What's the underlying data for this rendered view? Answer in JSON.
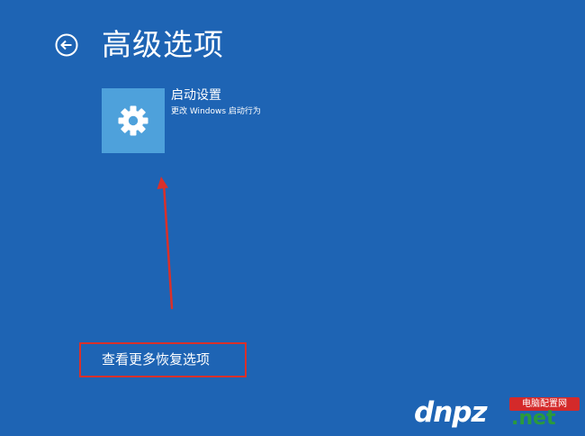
{
  "header": {
    "title": "高级选项",
    "back_icon": "back-arrow-circle-icon"
  },
  "options": [
    {
      "title": "启动设置",
      "description": "更改 Windows 启动行为",
      "icon": "gear-icon",
      "tile_color": "#4ea1db"
    }
  ],
  "more_options": {
    "label": "查看更多恢复选项",
    "highlight_color": "#d9302a"
  },
  "watermark": {
    "main": "dnpz",
    "domain": ".net",
    "badge": "电脑配置网"
  },
  "colors": {
    "background": "#1e64b4",
    "text": "#ffffff",
    "annotation": "#d9302a"
  }
}
